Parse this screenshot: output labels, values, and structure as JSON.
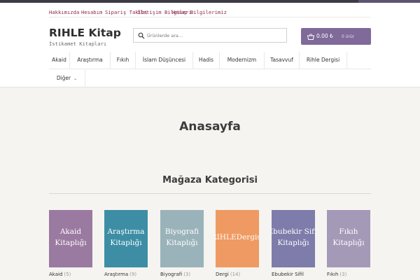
{
  "top_links": [
    "Hakkımızda",
    "Hesabım",
    "Sipariş Takibi",
    "İletişim Bilgileri",
    "Hesap Bilgilerimiz"
  ],
  "brand": {
    "title": "RIHLE Kitap",
    "tagline": "İstikamet Kitapları"
  },
  "search": {
    "placeholder": "Ürünlerde ara…",
    "icon": "search-icon"
  },
  "cart": {
    "amount": "0.00 ₺",
    "count": "0 ürür",
    "icon": "basket-icon"
  },
  "nav": {
    "items": [
      "Akaid",
      "Araştırma",
      "Fıkıh",
      "İslam Düşüncesi",
      "Hadis",
      "Modernizm",
      "Tasavvuf",
      "Rihle Dergisi"
    ],
    "more_label": "Diğer",
    "more_icon": "chevron-down-icon"
  },
  "page_title": "Anasayfa",
  "section_title": "Mağaza Kategorisi",
  "categories": [
    {
      "tile_line1": "Akaid",
      "tile_line2": "Kitaplığı",
      "name": "Akaid",
      "count": "(5)",
      "color": "#9a7aa0"
    },
    {
      "tile_line1": "Araştırma",
      "tile_line2": "Kitaplığı",
      "name": "Araştırma",
      "count": "(9)",
      "color": "#3d8ea5"
    },
    {
      "tile_line1": "Biyografi",
      "tile_line2": "Kitaplığı",
      "name": "Biyografi",
      "count": "(3)",
      "color": "#9ab3ba"
    },
    {
      "tile_line1": "RIHLEDergisi",
      "tile_line2": "",
      "name": "Dergi",
      "count": "(14)",
      "color": "#ef9a62"
    },
    {
      "tile_line1": "Ebubekir Sifil",
      "tile_line2": "Kitaplığı",
      "name": "Ebubekir Sifil",
      "count": "",
      "color": "#7d7caa"
    },
    {
      "tile_line1": "Fıkıh",
      "tile_line2": "Kitaplığı",
      "name": "Fıkıh",
      "count": "(3)",
      "color": "#a599b8"
    }
  ]
}
